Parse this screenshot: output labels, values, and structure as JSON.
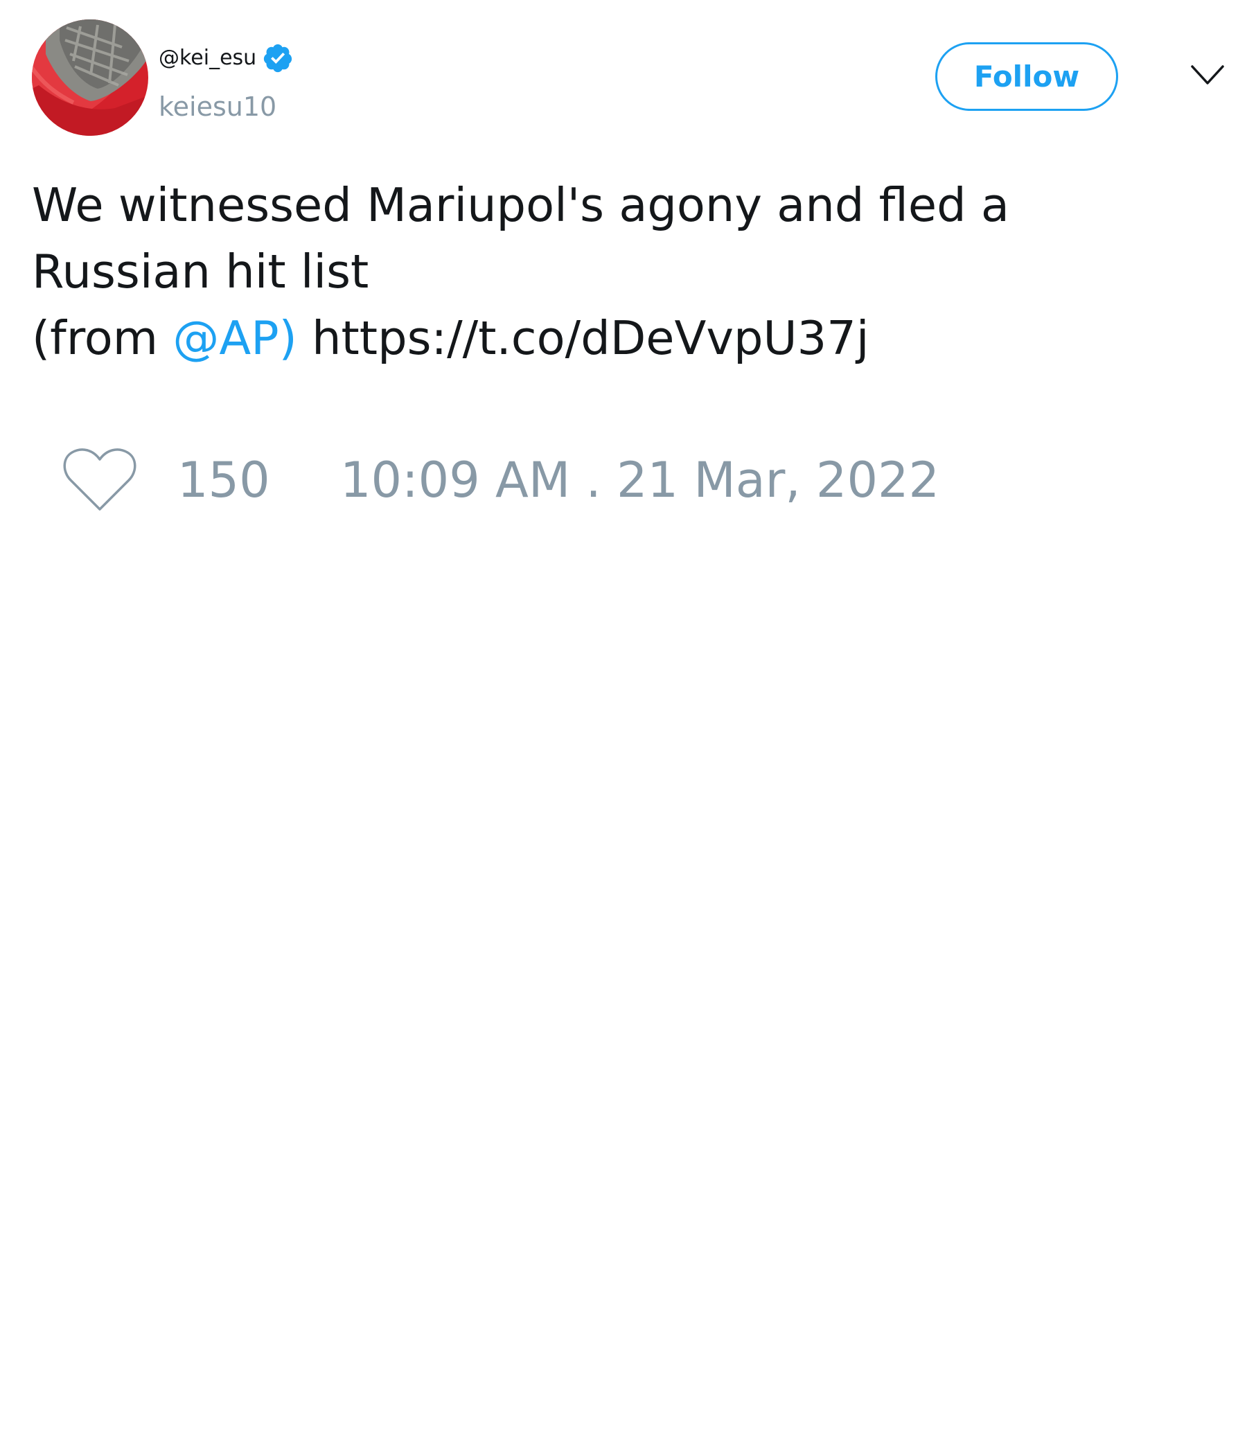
{
  "author": {
    "display_name": "@kei_esu",
    "handle": "keiesu10",
    "verified": true,
    "avatar_icon": "sneaker-photo-avatar"
  },
  "header": {
    "follow_label": "Follow",
    "menu_icon": "chevron-down-icon"
  },
  "tweet": {
    "line1": "We witnessed Mariupol's agony and fled a",
    "line2": "Russian hit list",
    "line3_prefix": "(from ",
    "mention": "@AP)",
    "link": "https://t.co/dDeVvpU37j"
  },
  "footer": {
    "like_icon": "heart-icon",
    "like_count": "150",
    "timestamp": "10:09 AM . 21 Mar, 2022"
  },
  "colors": {
    "accent": "#1da1f2",
    "muted": "#8899a6",
    "text": "#14171a"
  }
}
